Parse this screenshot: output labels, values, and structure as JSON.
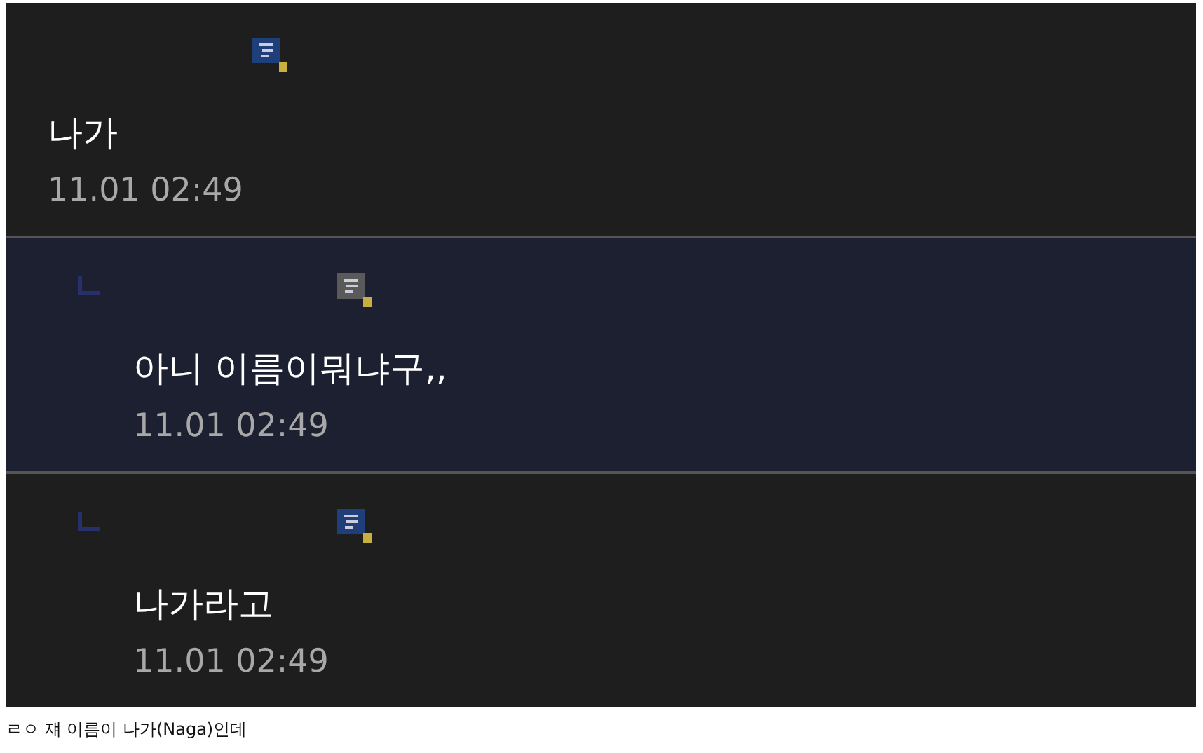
{
  "comments": [
    {
      "kind": "comment",
      "selected": false,
      "color": "#1f3f7a",
      "text": "나가",
      "time": "11.01 02:49"
    },
    {
      "kind": "reply",
      "selected": true,
      "color": "#5a5a5a",
      "text": "아니 이름이뭐냐구,,",
      "time": "11.01 02:49"
    },
    {
      "kind": "reply",
      "selected": false,
      "color": "#1f3f7a",
      "text": "나가라고",
      "time": "11.01 02:49"
    }
  ],
  "caption": "ㄹㅇ 쟤 이름이 나가(Naga)인데"
}
